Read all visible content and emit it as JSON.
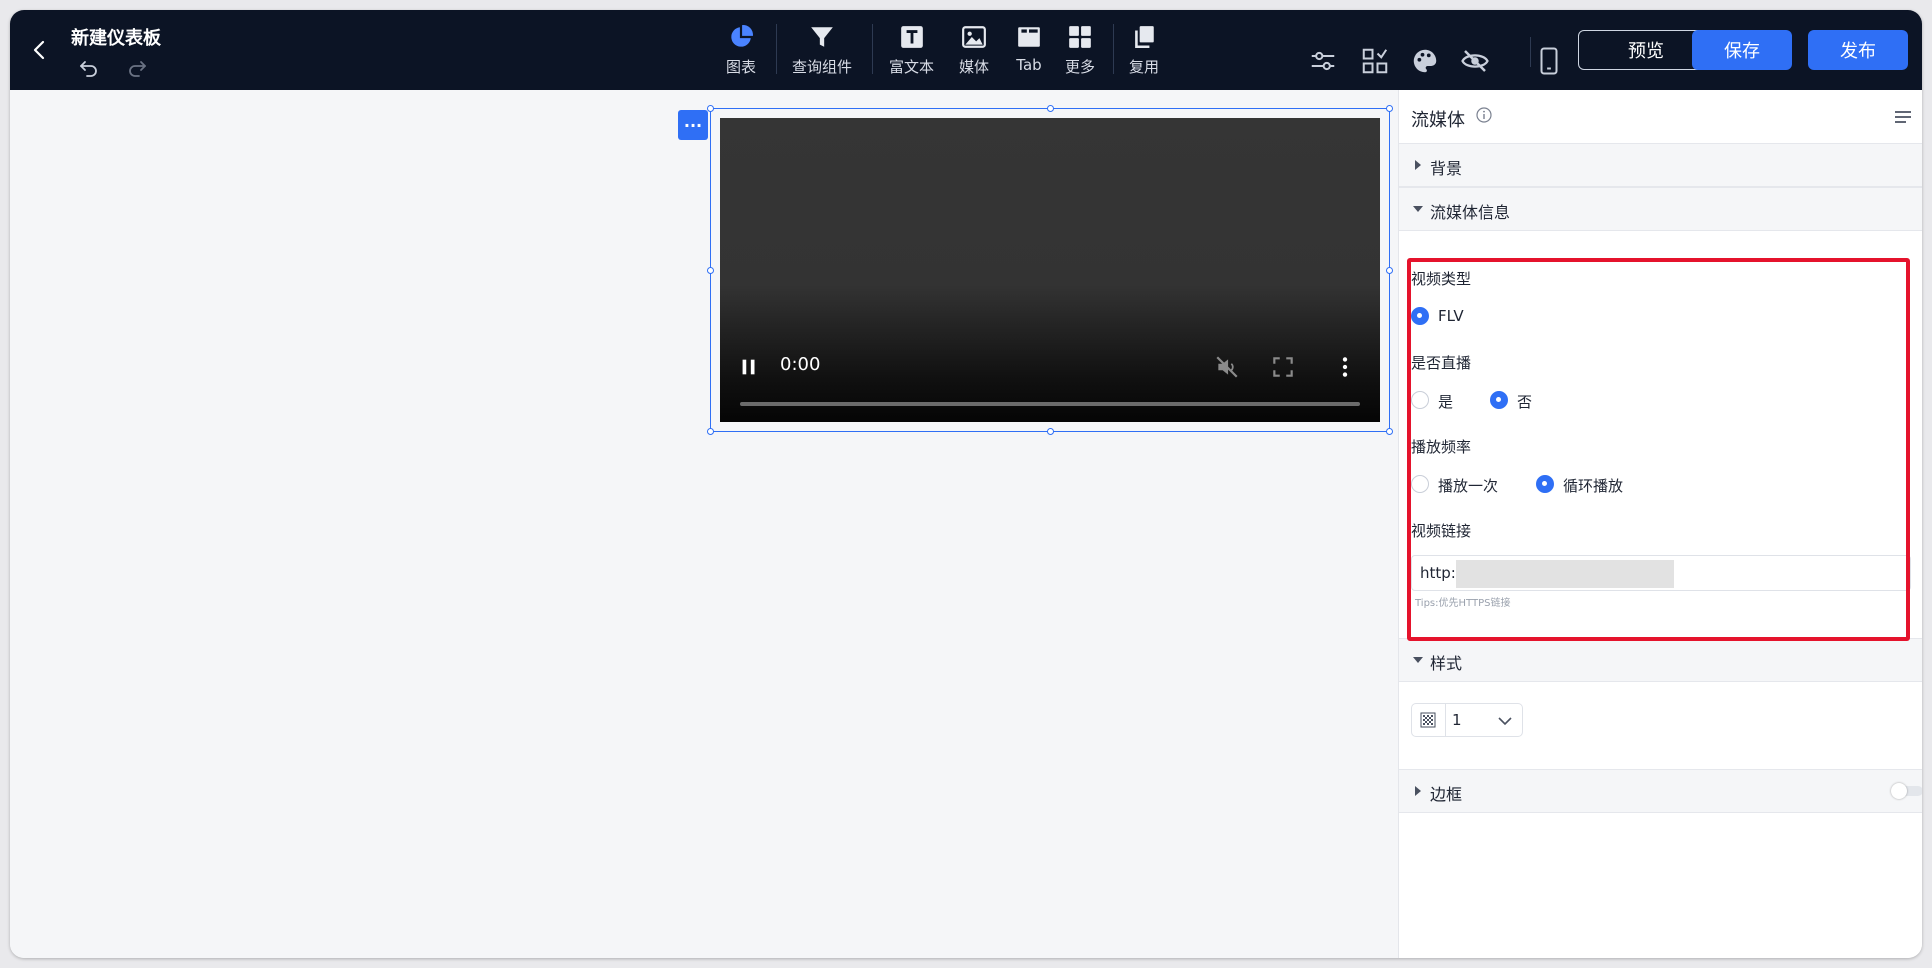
{
  "header": {
    "title": "新建仪表板",
    "toolbar": {
      "chart_label": "图表",
      "query_label": "查询组件",
      "richtext_label": "富文本",
      "media_label": "媒体",
      "tab_label": "Tab",
      "more_label": "更多",
      "reuse_label": "复用"
    },
    "preview_label": "预览",
    "save_label": "保存",
    "publish_label": "发布"
  },
  "video": {
    "time": "0:00"
  },
  "panel": {
    "title": "流媒体",
    "sections": {
      "background": "背景",
      "stream_info": "流媒体信息",
      "style": "样式",
      "border": "边框"
    },
    "video_type": {
      "label": "视频类型",
      "options": [
        "FLV"
      ],
      "selected": "FLV"
    },
    "is_live": {
      "label": "是否直播",
      "options": [
        "是",
        "否"
      ],
      "selected": "否"
    },
    "play_frequency": {
      "label": "播放频率",
      "options": [
        "播放一次",
        "循环播放"
      ],
      "selected": "循环播放"
    },
    "video_url": {
      "label": "视频链接",
      "value": "http:",
      "tips": "Tips:优先HTTPS链接"
    },
    "opacity": {
      "value": "1"
    },
    "border_enabled": false
  },
  "colors": {
    "header_bg": "#0c1425",
    "primary": "#2f6ff5",
    "highlight": "#e5132c"
  }
}
